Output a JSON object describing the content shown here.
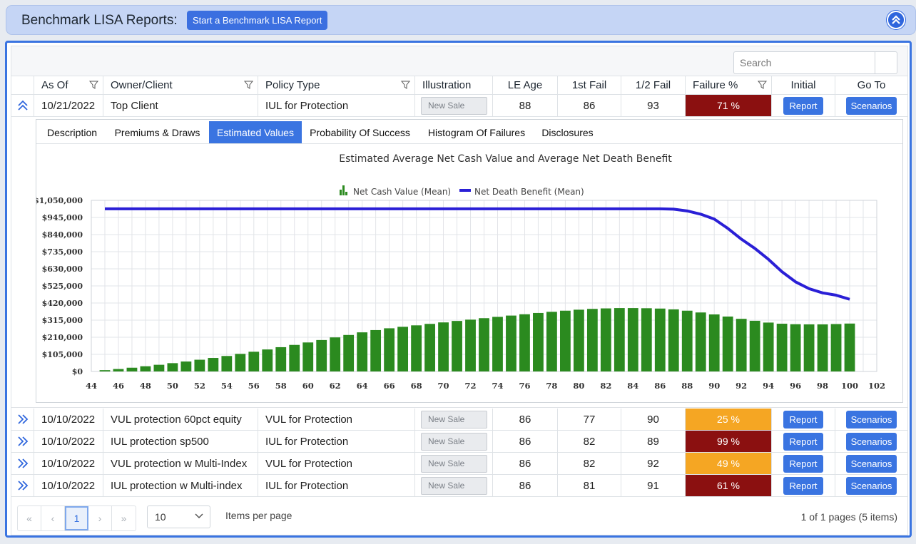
{
  "header": {
    "title": "Benchmark LISA Reports:",
    "start_button": "Start a Benchmark LISA Report"
  },
  "search": {
    "placeholder": "Search"
  },
  "columns": [
    "As Of",
    "Owner/Client",
    "Policy Type",
    "Illustration",
    "LE Age",
    "1st Fail",
    "1/2 Fail",
    "Failure %",
    "Initial",
    "Go To"
  ],
  "expanded_row": {
    "as_of": "10/21/2022",
    "owner": "Top Client",
    "policy_type": "IUL for Protection",
    "illustration": "New Sale",
    "le_age": "88",
    "first_fail": "86",
    "half_fail": "93",
    "failure_pct": "71 %",
    "failure_color": "#8b1010",
    "initial": "Report",
    "goto": "Scenarios"
  },
  "tabs": [
    "Description",
    "Premiums & Draws",
    "Estimated Values",
    "Probability Of Success",
    "Histogram Of Failures",
    "Disclosures"
  ],
  "active_tab": "Estimated Values",
  "chart_data": {
    "type": "bar+line",
    "title": "Estimated Average Net Cash Value and Average Net Death Benefit",
    "legend": [
      "Net Cash Value (Mean)",
      "Net Death Benefit (Mean)"
    ],
    "legend_position": "top",
    "xlim": [
      44,
      102
    ],
    "xticks": [
      44,
      46,
      48,
      50,
      52,
      54,
      56,
      58,
      60,
      62,
      64,
      66,
      68,
      70,
      72,
      74,
      76,
      78,
      80,
      82,
      84,
      86,
      88,
      90,
      92,
      94,
      96,
      98,
      100,
      102
    ],
    "ylim": [
      0,
      1050000
    ],
    "yticks": [
      "$0",
      "$105,000",
      "$210,000",
      "$315,000",
      "$420,000",
      "$525,000",
      "$630,000",
      "$735,000",
      "$840,000",
      "$945,000",
      "$1,050,000"
    ],
    "grid": true,
    "bar_color": "#2b8a1f",
    "line_color": "#2a1fd6",
    "x": [
      45,
      46,
      47,
      48,
      49,
      50,
      51,
      52,
      53,
      54,
      55,
      56,
      57,
      58,
      59,
      60,
      61,
      62,
      63,
      64,
      65,
      66,
      67,
      68,
      69,
      70,
      71,
      72,
      73,
      74,
      75,
      76,
      77,
      78,
      79,
      80,
      81,
      82,
      83,
      84,
      85,
      86,
      87,
      88,
      89,
      90,
      91,
      92,
      93,
      94,
      95,
      96,
      97,
      98,
      99,
      100
    ],
    "net_cash_value": [
      8000,
      15000,
      23000,
      32000,
      41000,
      51000,
      61000,
      72000,
      83000,
      95000,
      108000,
      121000,
      135000,
      149000,
      163000,
      178000,
      193000,
      209000,
      224000,
      240000,
      254000,
      265000,
      274000,
      283000,
      292000,
      301000,
      310000,
      318000,
      327000,
      335000,
      343000,
      351000,
      359000,
      366000,
      373000,
      379000,
      384000,
      387000,
      389000,
      389000,
      388000,
      386000,
      381000,
      373000,
      362000,
      350000,
      337000,
      323000,
      311000,
      300000,
      293000,
      290000,
      289000,
      289000,
      291000,
      294000
    ],
    "net_death_benefit": [
      998000,
      998000,
      998000,
      998000,
      998000,
      998000,
      998000,
      998000,
      998000,
      998000,
      998000,
      998000,
      998000,
      998000,
      998000,
      998000,
      998000,
      998000,
      998000,
      998000,
      998000,
      998000,
      998000,
      998000,
      998000,
      998000,
      998000,
      998000,
      998000,
      998000,
      998000,
      998000,
      998000,
      998000,
      998000,
      998000,
      998000,
      998000,
      998000,
      998000,
      998000,
      998000,
      996000,
      985000,
      965000,
      935000,
      878000,
      812000,
      755000,
      688000,
      612000,
      550000,
      508000,
      482000,
      468000,
      443000
    ]
  },
  "rows": [
    {
      "as_of": "10/10/2022",
      "owner": "VUL protection 60pct equity",
      "policy_type": "VUL for Protection",
      "illustration": "New Sale",
      "le_age": "86",
      "first_fail": "77",
      "half_fail": "90",
      "failure_pct": "25 %",
      "failure_color": "#f5a623",
      "initial": "Report",
      "goto": "Scenarios"
    },
    {
      "as_of": "10/10/2022",
      "owner": "IUL protection sp500",
      "policy_type": "IUL for Protection",
      "illustration": "New Sale",
      "le_age": "86",
      "first_fail": "82",
      "half_fail": "89",
      "failure_pct": "99 %",
      "failure_color": "#8b1010",
      "initial": "Report",
      "goto": "Scenarios"
    },
    {
      "as_of": "10/10/2022",
      "owner": "VUL protection w Multi-Index",
      "policy_type": "VUL for Protection",
      "illustration": "New Sale",
      "le_age": "86",
      "first_fail": "82",
      "half_fail": "92",
      "failure_pct": "49 %",
      "failure_color": "#f5a623",
      "initial": "Report",
      "goto": "Scenarios"
    },
    {
      "as_of": "10/10/2022",
      "owner": "IUL protection w Multi-index",
      "policy_type": "IUL for Protection",
      "illustration": "New Sale",
      "le_age": "86",
      "first_fail": "81",
      "half_fail": "91",
      "failure_pct": "61 %",
      "failure_color": "#8b1010",
      "initial": "Report",
      "goto": "Scenarios"
    }
  ],
  "pager": {
    "first": "«",
    "prev": "‹",
    "current": "1",
    "next": "›",
    "last": "»",
    "page_size": "10",
    "items_per_page_label": "Items per page",
    "info": "1 of 1 pages (5 items)"
  }
}
